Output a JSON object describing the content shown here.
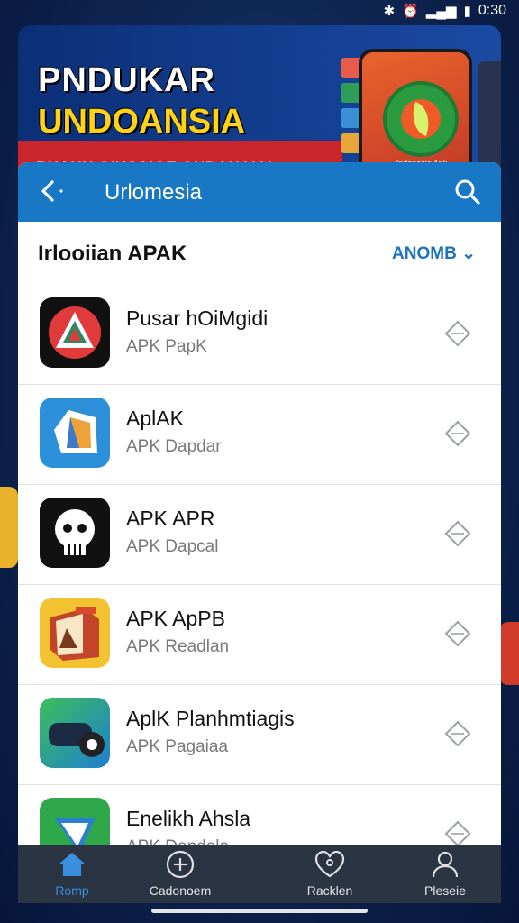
{
  "status_bar": {
    "time": "0:30"
  },
  "banner": {
    "line1": "PNDUKAR",
    "line2": "UNDOANSIA",
    "line3": "BKAUN OIUSAIGE ONDANAIAI",
    "logo_caption": "Indonesia Apk"
  },
  "app_bar": {
    "title": "Urlomesia"
  },
  "section": {
    "title": "Irlooiian APAK",
    "sort_label": "ANOMB"
  },
  "apps": [
    {
      "title": "Pusar hOiMgidi",
      "subtitle": "APK PapK",
      "icon": "red-triangle-app-icon"
    },
    {
      "title": "AplAK",
      "subtitle": "APK Dapdar",
      "icon": "blue-polygon-app-icon"
    },
    {
      "title": "APK APR",
      "subtitle": "APK Dapcal",
      "icon": "skull-app-icon"
    },
    {
      "title": "APK ApPB",
      "subtitle": "APK Readlan",
      "icon": "book-app-icon"
    },
    {
      "title": "AplK Planhmtiagis",
      "subtitle": "APK Pagaiaa",
      "icon": "vr-headset-app-icon"
    },
    {
      "title": "Enelikh Ahsla",
      "subtitle": "APK Dapdala",
      "icon": "green-app-icon"
    }
  ],
  "bottom_nav": [
    {
      "label": "Romp",
      "icon": "home-icon"
    },
    {
      "label": "Cadonoem",
      "icon": "plus-circle-icon"
    },
    {
      "label": "Racklen",
      "icon": "heart-icon"
    },
    {
      "label": "Pleseie",
      "icon": "profile-icon"
    }
  ],
  "colors": {
    "app_bar": "#1878c6",
    "accent": "#1d73bd",
    "nav_bg": "#2b3442",
    "banner_red": "#c8262b",
    "banner_yellow": "#ffd21a"
  }
}
